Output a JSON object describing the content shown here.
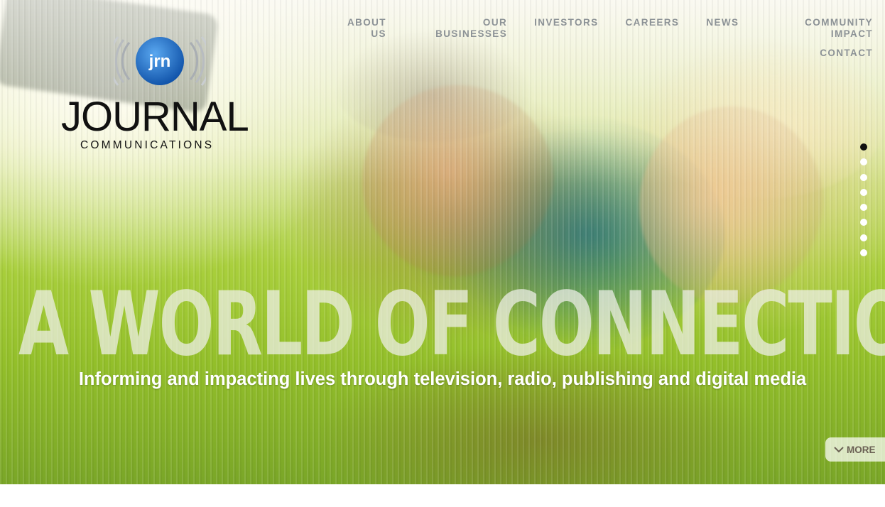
{
  "brand": {
    "mark_text": "jrn",
    "name": "JOURNAL",
    "tagline": "COMMUNICATIONS"
  },
  "nav": {
    "items": [
      {
        "label": "ABOUT US"
      },
      {
        "label": "OUR BUSINESSES"
      },
      {
        "label": "INVESTORS"
      },
      {
        "label": "CAREERS"
      },
      {
        "label": "NEWS"
      },
      {
        "label": "COMMUNITY IMPACT"
      },
      {
        "label": "CONTACT"
      }
    ]
  },
  "hero": {
    "headline": "A WORLD OF CONNECTIONS",
    "subheadline": "Informing and impacting lives through television, radio, publishing and digital media",
    "more_label": "MORE",
    "slides": {
      "count": 8,
      "active_index": 0
    }
  },
  "colors": {
    "nav_text": "#8c9296",
    "logo_blue": "#1a6fd0",
    "active_dot": "#111111"
  }
}
